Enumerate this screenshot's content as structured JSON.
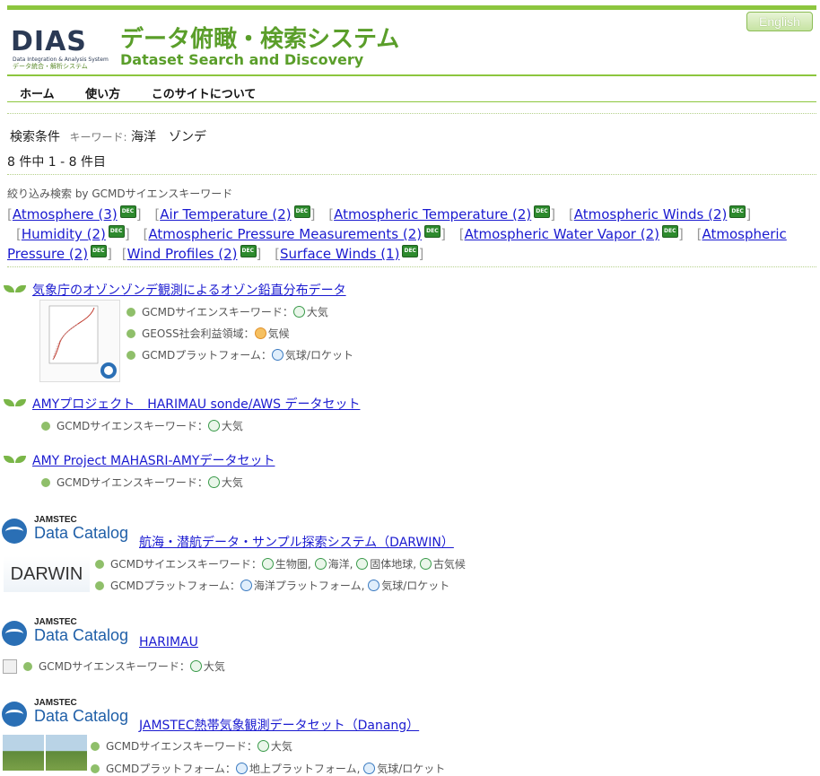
{
  "header": {
    "logo_text": "DIAS",
    "logo_sub_en": "Data Integration & Analysis System",
    "logo_sub_ja": "データ統合・解析システム",
    "title_ja": "データ俯瞰・検索システム",
    "title_en": "Dataset Search and Discovery",
    "lang_button": "English"
  },
  "nav": {
    "items": [
      "ホーム",
      "使い方",
      "このサイトについて"
    ]
  },
  "search": {
    "cond_label": "検索条件",
    "kw_label": "キーワード:",
    "kw_value": "海洋　ゾンデ",
    "count": "8 件中 1 - 8 件目"
  },
  "refine": {
    "title": "絞り込み検索 by GCMDサイエンスキーワード",
    "keywords": [
      "Atmosphere (3)",
      "Air Temperature (2)",
      "Atmospheric Temperature (2)",
      "Atmospheric Winds (2)",
      "Humidity (2)",
      "Atmospheric Pressure Measurements (2)",
      "Atmospheric Water Vapor (2)",
      "Atmospheric Pressure (2)",
      "Wind Profiles (2)",
      "Surface Winds (1)"
    ]
  },
  "results": [
    {
      "title": "気象庁のオゾンゾンデ観測によるオゾン鉛直分布データ",
      "meta": [
        {
          "label": "GCMDサイエンスキーワード：",
          "value": "大気"
        },
        {
          "label": "GEOSS社会利益領域：",
          "value": "気候"
        },
        {
          "label": "GCMDプラットフォーム：",
          "value": "気球/ロケット"
        }
      ]
    },
    {
      "title": "AMYプロジェクト　HARIMAU sonde/AWS データセット",
      "meta": [
        {
          "label": "GCMDサイエンスキーワード：",
          "value": "大気"
        }
      ]
    },
    {
      "title": "AMY Project MAHASRI-AMYデータセット",
      "meta": [
        {
          "label": "GCMDサイエンスキーワード：",
          "value": "大気"
        }
      ]
    },
    {
      "title": "航海・潜航データ・サンプル探索システム（DARWIN）",
      "thumb_text": "DARWIN",
      "meta": [
        {
          "label": "GCMDサイエンスキーワード：",
          "values": [
            "生物圏",
            "海洋",
            "固体地球",
            "古気候"
          ]
        },
        {
          "label": "GCMDプラットフォーム：",
          "values": [
            "海洋プラットフォーム",
            "気球/ロケット"
          ]
        }
      ]
    },
    {
      "title": "HARIMAU",
      "meta": [
        {
          "label": "GCMDサイエンスキーワード：",
          "value": "大気"
        }
      ]
    },
    {
      "title": "JAMSTEC熱帯気象観測データセット（Danang）",
      "meta": [
        {
          "label": "GCMDサイエンスキーワード：",
          "value": "大気"
        },
        {
          "label": "GCMDプラットフォーム：",
          "values": [
            "地上プラットフォーム",
            "気球/ロケット"
          ]
        }
      ]
    }
  ],
  "jamstec": {
    "line1": "JAMSTEC",
    "line2": "Data Catalog"
  },
  "colors": {
    "accent_green": "#8cc63e",
    "title_green": "#5a9e2a",
    "link_blue": "#1a1ad0"
  }
}
